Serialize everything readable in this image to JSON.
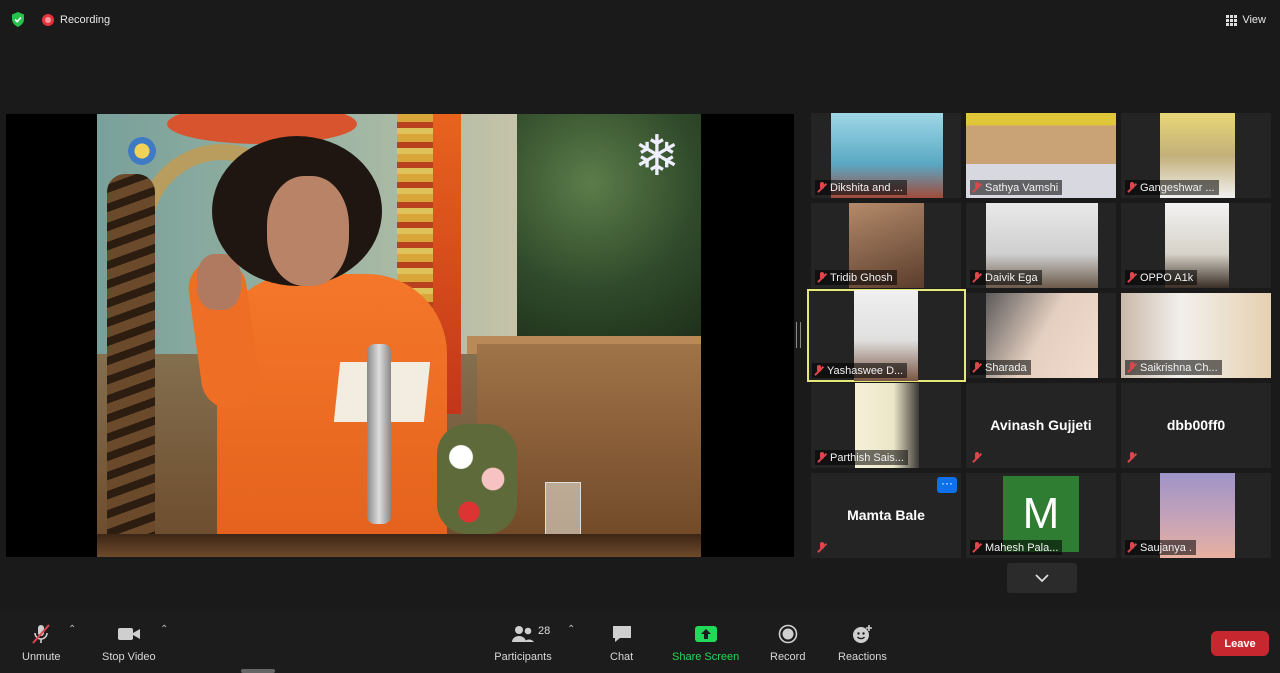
{
  "top": {
    "recording_label": "Recording",
    "view_label": "View"
  },
  "participants_tiles": [
    {
      "name": "Dikshita and ..."
    },
    {
      "name": "Sathya Vamshi"
    },
    {
      "name": "Gangeshwar ..."
    },
    {
      "name": "Tridib Ghosh"
    },
    {
      "name": "Daivik Ega"
    },
    {
      "name": "OPPO A1k"
    },
    {
      "name": "Yashaswee D..."
    },
    {
      "name": "Sharada"
    },
    {
      "name": "Saikrishna Ch..."
    },
    {
      "name": "Parthish Sais..."
    },
    {
      "name": "Avinash Gujjeti"
    },
    {
      "name": "dbb00ff0"
    },
    {
      "name": "Mamta Bale",
      "more": "···"
    },
    {
      "name": "Mahesh Pala...",
      "initial": "M"
    },
    {
      "name": "Saujanya ."
    }
  ],
  "toolbar": {
    "unmute": "Unmute",
    "stop_video": "Stop Video",
    "participants": "Participants",
    "participants_count": "28",
    "chat": "Chat",
    "share_screen": "Share Screen",
    "record": "Record",
    "reactions": "Reactions",
    "leave": "Leave"
  },
  "colors": {
    "leave": "#c7282f",
    "share_screen": "#23d959",
    "active_speaker": "#e6e87a",
    "recording": "#e8323c"
  }
}
